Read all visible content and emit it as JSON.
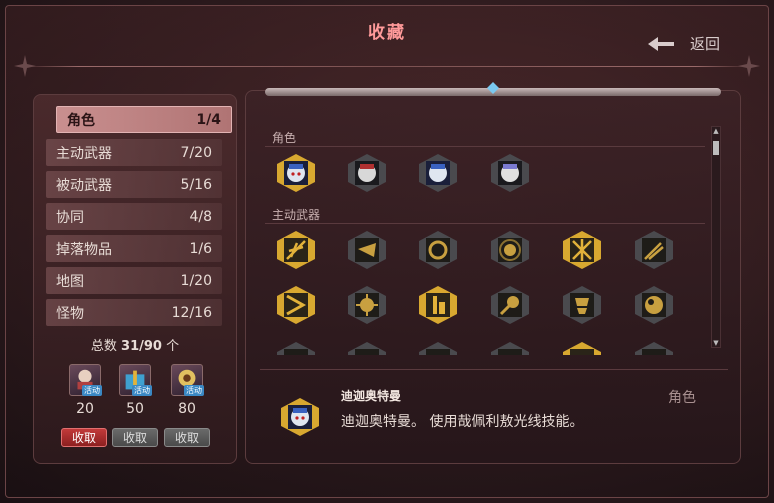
{
  "header": {
    "title": "收藏",
    "back_label": "返回"
  },
  "categories": [
    {
      "label": "角色",
      "count": "1/4",
      "active": true
    },
    {
      "label": "主动武器",
      "count": "7/20"
    },
    {
      "label": "被动武器",
      "count": "5/16"
    },
    {
      "label": "协同",
      "count": "4/8"
    },
    {
      "label": "掉落物品",
      "count": "1/6"
    },
    {
      "label": "地图",
      "count": "1/20"
    },
    {
      "label": "怪物",
      "count": "12/16"
    }
  ],
  "total": {
    "label": "总数",
    "value": "31/90",
    "unit": "个"
  },
  "rewards": [
    {
      "value": "20",
      "tag": "活动",
      "claim_label": "收取",
      "highlighted": true
    },
    {
      "value": "50",
      "tag": "活动",
      "claim_label": "收取"
    },
    {
      "value": "80",
      "tag": "活动",
      "claim_label": "收取"
    }
  ],
  "grid": {
    "sections": [
      {
        "label": "角色"
      },
      {
        "label": "主动武器"
      }
    ]
  },
  "detail": {
    "name": "迪迦奥特曼",
    "description": "迪迦奥特曼。 使用哉佩利敖光线技能。",
    "category": "角色"
  },
  "colors": {
    "accent": "#ff9a9a",
    "gold": "#e2b23a",
    "claim_red": "#c23a3a"
  }
}
